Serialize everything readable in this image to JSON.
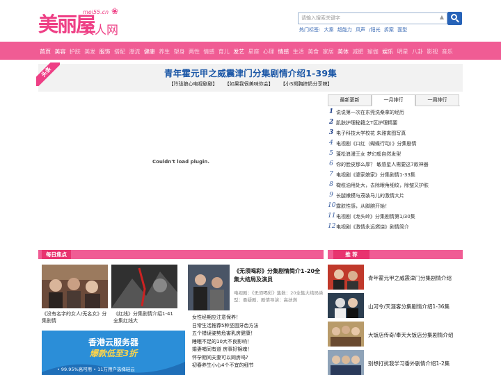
{
  "logo": {
    "cn": "美丽屋",
    "site": "mei55.cn",
    "sub": "女人网"
  },
  "search": {
    "placeholder": "请输入搜索关键字",
    "dropdown": "▲"
  },
  "hot": {
    "label": "热门标签:",
    "tags": [
      "大秦",
      "超能力",
      "风声",
      "/阳光",
      "拆案",
      "面型"
    ]
  },
  "nav": [
    {
      "label": "首页",
      "strong": true
    },
    {
      "label": "美容",
      "strong": true
    },
    {
      "label": "护肤",
      "strong": false
    },
    {
      "label": "美发",
      "strong": false
    },
    {
      "label": "服饰",
      "strong": true
    },
    {
      "label": "搭配",
      "strong": false
    },
    {
      "label": "潮流",
      "strong": false
    },
    {
      "label": "健康",
      "strong": true
    },
    {
      "label": "养生",
      "strong": false
    },
    {
      "label": "塑身",
      "strong": false
    },
    {
      "label": "两性",
      "strong": false
    },
    {
      "label": "情感",
      "strong": false
    },
    {
      "label": "育儿",
      "strong": false
    },
    {
      "label": "发艺",
      "strong": true
    },
    {
      "label": "星座",
      "strong": false
    },
    {
      "label": "心理",
      "strong": false
    },
    {
      "label": "情感",
      "strong": true
    },
    {
      "label": "生活",
      "strong": false
    },
    {
      "label": "美食",
      "strong": false
    },
    {
      "label": "家居",
      "strong": false
    },
    {
      "label": "美体",
      "strong": true
    },
    {
      "label": "减肥",
      "strong": false
    },
    {
      "label": "瑜伽",
      "strong": false
    },
    {
      "label": "娱乐",
      "strong": true
    },
    {
      "label": "明星",
      "strong": false
    },
    {
      "label": "八卦",
      "strong": false
    },
    {
      "label": "影视",
      "strong": false
    },
    {
      "label": "音乐",
      "strong": false
    }
  ],
  "ribbon": "头条",
  "headline": "青年霍元甲之威震津门分集剧情介绍1-39集",
  "sublinks": [
    "【玲珑狼心电视剧剧】",
    "【如果我很美味你会】",
    "【小S揭胸挤奶分享辣】"
  ],
  "plugin_msg": "Couldn't load plugin.",
  "tabs": [
    "最新更新",
    "一月排行",
    "一周排行"
  ],
  "rank": [
    "说说第一次在东莞洗桑拿的经历",
    "肌肤护理秘籍之T区护理精要",
    "电子科技大学校花 朱雅禽图写真",
    "电视剧《口红（蝴蝶行动）》分集剧情",
    "蓬松浪漫王女 梦幻般自然发型",
    "你的脸皮那么厚？ 敏感星人需要这7款神器",
    "电视剧《婆家娘家》分集剧情1-33集",
    "橄榄油用处大，去除眼角细纹，除皱又护肤",
    "长腿嫩模与茂装马儿的激情大片",
    "露肤性感，从脚腕开始！",
    "电视剧《龙头岭》分集剧情第1/30集",
    "电视剧《激情永远燃烧》剧情简介"
  ],
  "focus": {
    "label": "每日焦点",
    "items": [
      "《没有名字的女人/无名女》分集剧情",
      "《红线》分集剧情介绍1-41全集红线大"
    ]
  },
  "feature": {
    "title": "《无须喝彩》分集剧情简介1-20全集大结局及演员",
    "desc": "电视剧：《无须喝彩》集数：20全集大结局类型：悬疑剧、剧情导演：高扶满"
  },
  "mlist": [
    "女性经期应注意保养！",
    "日常生活推荐5种坚固牙齿方法",
    "五个错误姿势危害乳房健康！",
    "睡眠不足的10大不良影响！",
    "婚妻哺同有道 房事好锦魂！",
    "怀孕期间夫妻可以同房吗?",
    "初春养生小心4个不宜的细节"
  ],
  "ad": {
    "t1": "香港云服务器",
    "t2": "爆款低至3折",
    "t3": "• 99.95%高可用  • 11万用户选择硅云"
  },
  "recommend": {
    "label": "推 荐",
    "items": [
      "青年霍元甲之威震津门分集剧情介绍",
      "山河令/天涯客分集剧情介绍1-36集",
      "大饭店传奇/奉天大饭店分集剧情介绍",
      "别想打扰我学习番外剧情介绍1-2集"
    ]
  },
  "colors": {
    "brand": "#ee3f85",
    "nav": "#f05c94",
    "link": "#1a56a6"
  }
}
